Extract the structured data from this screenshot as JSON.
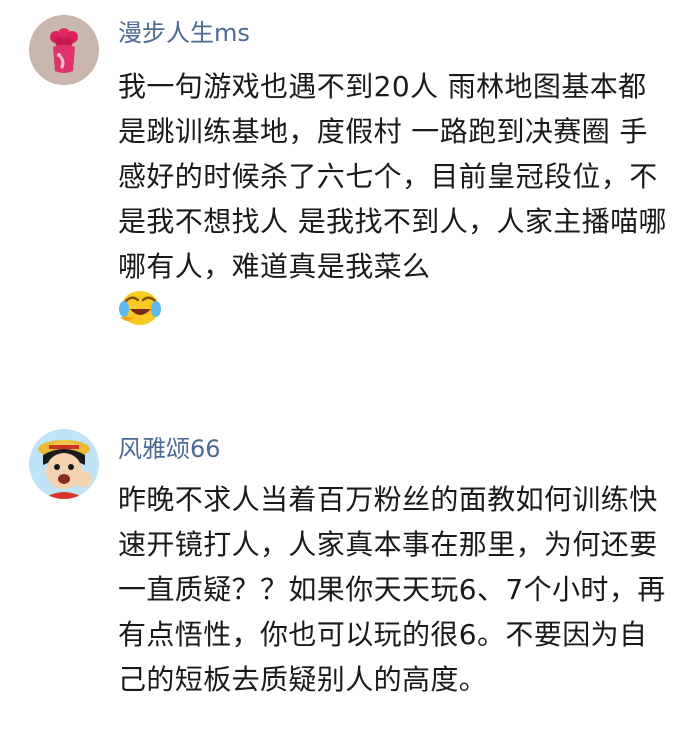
{
  "comments": [
    {
      "username": "漫步人生ms",
      "avatar_icon": "red-flower-avatar-icon",
      "text": "我一句游戏也遇不到20人 雨林地图基本都是跳训练基地，度假村 一路跑到决赛圈 手感好的时候杀了六七个，目前皇冠段位，不是我不想找人 是我找不到人，人家主播喵哪哪有人，难道真是我菜么",
      "emoji_icon": "crying-laughing-emoji-icon"
    },
    {
      "username": "风雅颂66",
      "avatar_icon": "cartoon-pirate-avatar-icon",
      "text": "昨晚不求人当着百万粉丝的面教如何训练快速开镜打人，人家真本事在那里，为何还要一直质疑？？如果你天天玩6、7个小时，再有点悟性，你也可以玩的很6。不要因为自己的短板去质疑别人的高度。"
    }
  ]
}
